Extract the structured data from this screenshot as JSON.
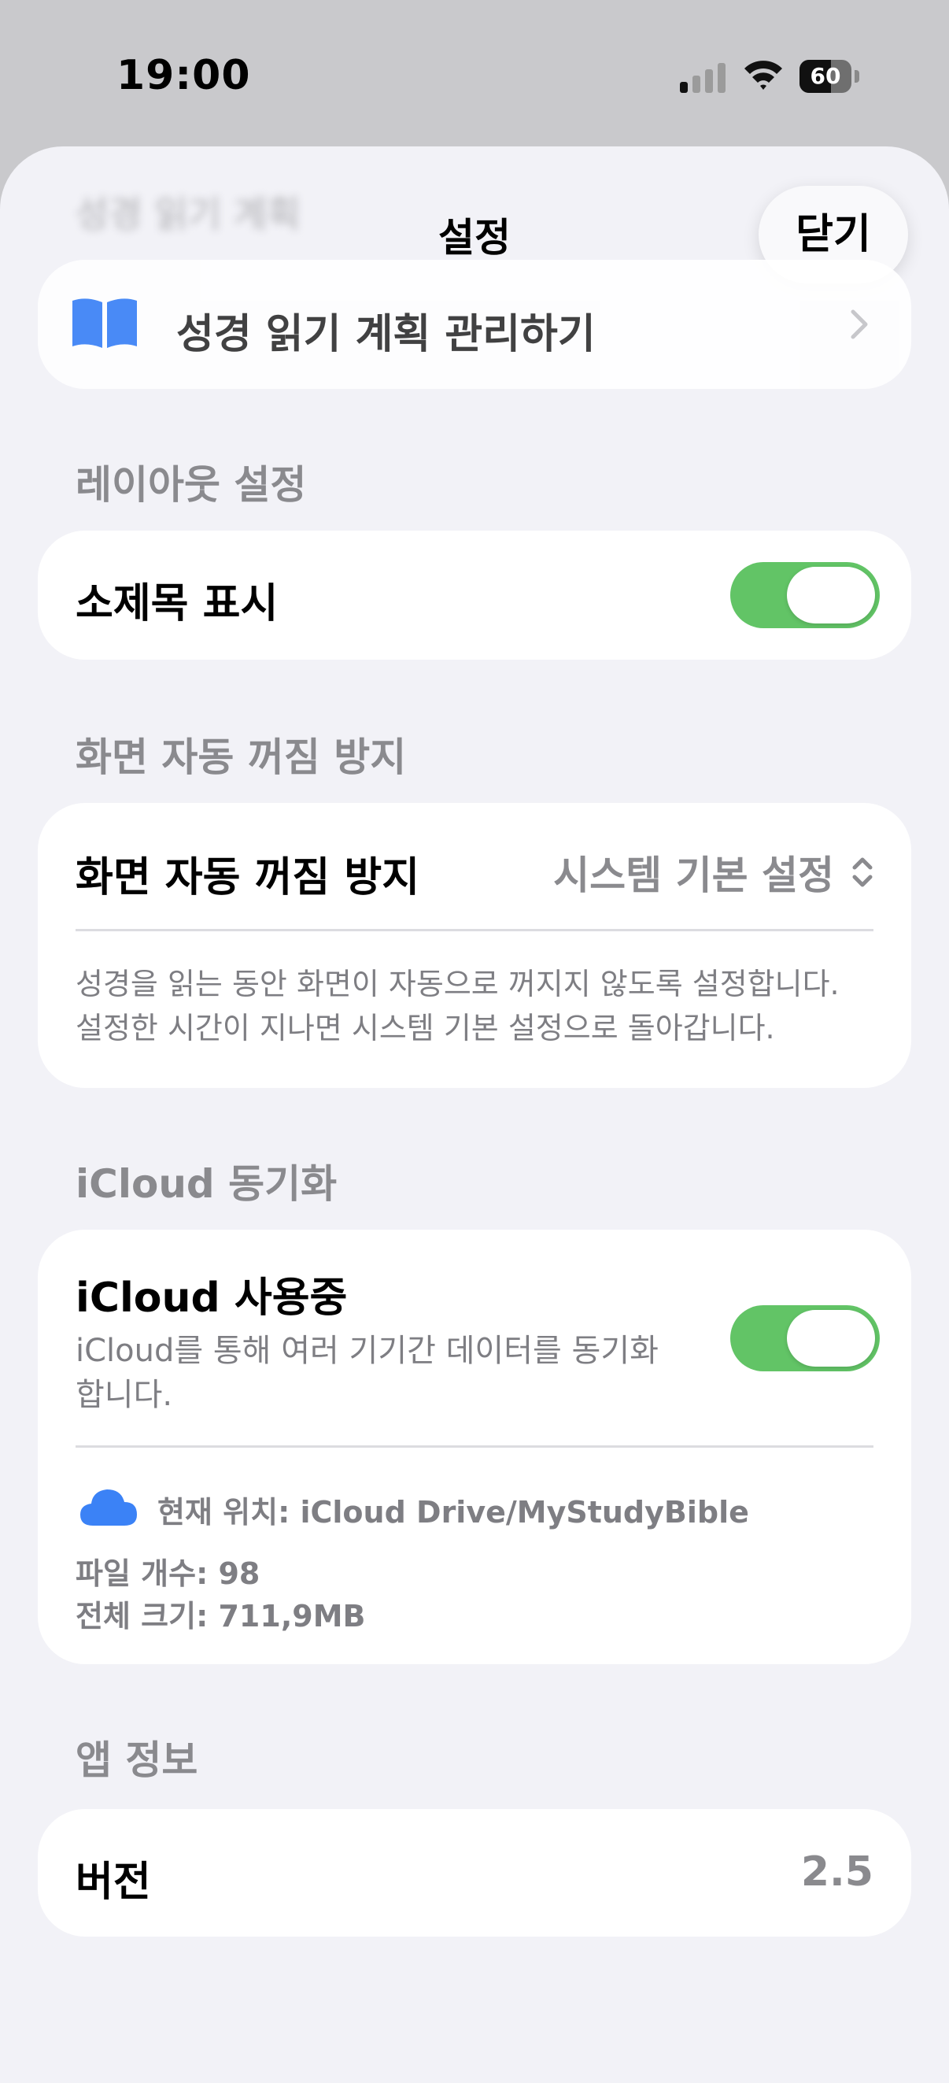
{
  "status_bar": {
    "time": "19:00",
    "battery_percent": "60",
    "signal_bars_active": 1,
    "signal_bars_total": 4
  },
  "nav": {
    "title": "설정",
    "close_label": "닫기",
    "ghost_title": "성경 읽기 계획"
  },
  "reading_plan": {
    "label": "성경 읽기 계획 관리하기",
    "icon": "book-icon"
  },
  "layout_section": {
    "header": "레이아웃 설정",
    "subtitle_label": "소제목 표시",
    "subtitle_on": true
  },
  "screen_section": {
    "header": "화면 자동 꺼짐 방지",
    "row_label": "화면 자동 꺼짐 방지",
    "row_value": "시스템 기본 설정",
    "footnote_line1": "성경을 읽는 동안 화면이 자동으로 꺼지지 않도록 설정합니다.",
    "footnote_line2": "설정한 시간이 지나면 시스템 기본 설정으로 돌아갑니다."
  },
  "icloud_section": {
    "header": "iCloud 동기화",
    "row_label": "iCloud 사용중",
    "row_desc_line1": "iCloud를 통해 여러 기기간 데이터를 동기화",
    "row_desc_line2": "합니다.",
    "enabled": true,
    "location": "현재 위치: iCloud Drive/MyStudyBible",
    "file_count": "파일 개수: 98",
    "total_size": "전체 크기: 711,9MB"
  },
  "app_info": {
    "header": "앱 정보",
    "version_label": "버전",
    "version_value": "2.5"
  },
  "colors": {
    "accent_green": "#62c466",
    "icon_blue": "#3b82f6",
    "secondary_text": "#8a8a8e"
  }
}
